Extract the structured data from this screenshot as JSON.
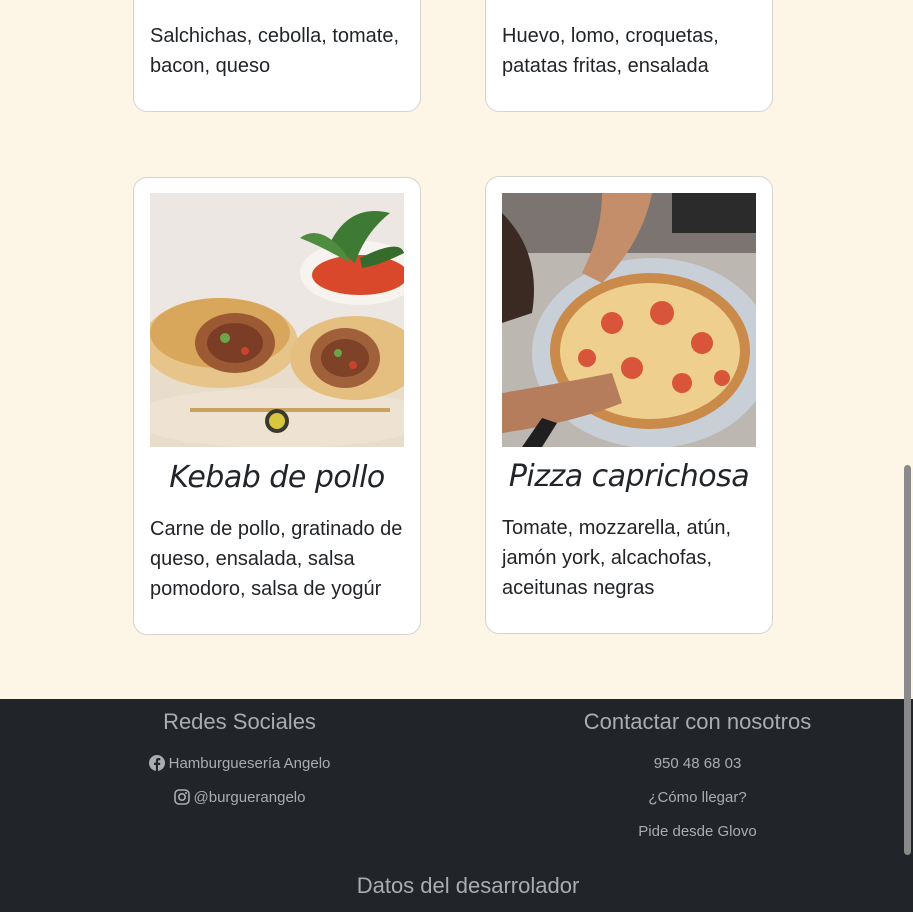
{
  "cards_top": [
    {
      "description": "Salchichas, cebolla, tomate, bacon, queso"
    },
    {
      "description": "Huevo, lomo, croquetas, patatas fritas, ensalada"
    }
  ],
  "cards": [
    {
      "title": "Kebab de pollo",
      "description": "Carne de pollo, gratinado de queso, ensalada, salsa pomodoro, salsa de yogúr",
      "image": "kebab-photo"
    },
    {
      "title": "Pizza caprichosa",
      "description": "Tomate, mozzarella, atún, jamón york, alcachofas, aceitunas negras",
      "image": "pizza-photo"
    }
  ],
  "footer": {
    "social": {
      "heading": "Redes Sociales",
      "facebook": {
        "label": "Hamburguesería Angelo",
        "icon": "facebook-icon"
      },
      "instagram": {
        "label": "@burguerangelo",
        "icon": "instagram-icon"
      }
    },
    "contact": {
      "heading": "Contactar con nosotros",
      "phone": "950 48 68 03",
      "directions": "¿Cómo llegar?",
      "glovo": "Pide desde Glovo"
    },
    "developer_heading": "Datos del desarrolador"
  },
  "colors": {
    "page_bg": "#fdf5e6",
    "footer_bg": "#212529",
    "footer_text": "#a9adb1"
  }
}
